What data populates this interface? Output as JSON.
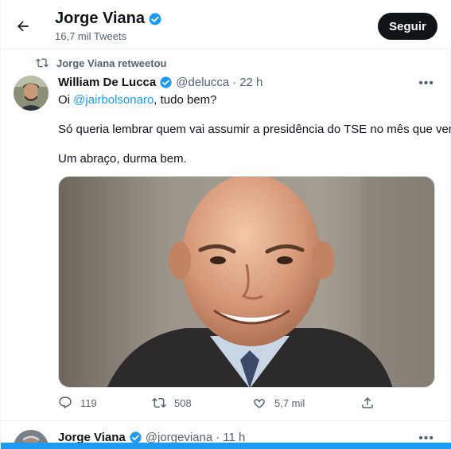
{
  "header": {
    "title": "Jorge Viana",
    "subtitle": "16,7 mil Tweets",
    "follow_label": "Seguir"
  },
  "tweet": {
    "retweeted_by": "Jorge Viana retweetou",
    "author_name": "William De Lucca",
    "handle": "@delucca",
    "separator": "·",
    "time": "22 h",
    "line1_prefix": "Oi ",
    "line1_mention": "@jairbolsonaro",
    "line1_suffix": ", tudo bem?",
    "line2": "Só queria lembrar quem vai assumir a presidência do TSE no mês que vem.",
    "line3": "Um abraço, durma bem.",
    "replies": "119",
    "retweets": "508",
    "likes": "5,7 mil"
  },
  "next_tweet": {
    "author_name": "Jorge Viana",
    "handle": "@jorgeviana",
    "separator": "·",
    "time": "11 h"
  },
  "colors": {
    "accent": "#1d9bf0",
    "text": "#0f1419",
    "muted": "#536471",
    "verified": "#1d9bf0"
  },
  "icons": [
    "back-arrow-icon",
    "verified-badge-icon",
    "retweet-icon",
    "more-icon",
    "reply-icon",
    "like-icon",
    "share-icon"
  ]
}
